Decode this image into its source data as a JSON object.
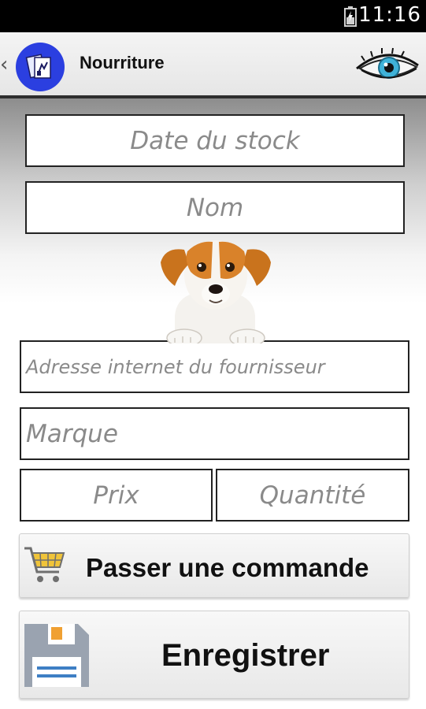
{
  "status_bar": {
    "time": "11:16"
  },
  "action_bar": {
    "title": "Nourriture"
  },
  "form": {
    "date_placeholder": "Date du stock",
    "name_placeholder": "Nom",
    "url_placeholder": "Adresse internet du fournisseur",
    "brand_placeholder": "Marque",
    "price_placeholder": "Prix",
    "quantity_placeholder": "Quantité"
  },
  "buttons": {
    "order_label": "Passer une commande",
    "save_label": "Enregistrer"
  },
  "colors": {
    "status_bar": "#000000",
    "action_bar": "#ececec",
    "app_logo": "#2b3fe0",
    "placeholder_text": "#8a8a8a",
    "save_icon": "#9aa3b0",
    "save_icon_accent": "#f0a032"
  },
  "icons": [
    "battery-icon",
    "back-chevron-icon",
    "app-logo-icon",
    "eye-icon",
    "dog-illustration",
    "shopping-cart-icon",
    "floppy-disk-icon"
  ]
}
